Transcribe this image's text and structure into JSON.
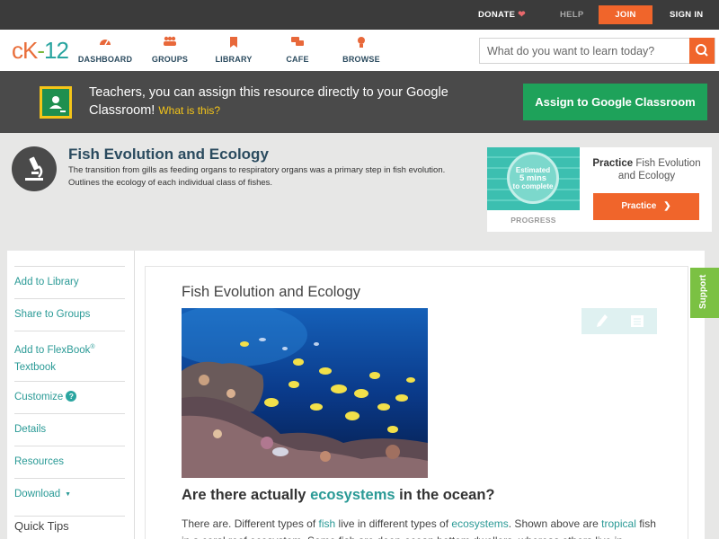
{
  "topbar": {
    "donate": "DONATE",
    "help": "HELP",
    "join": "JOIN",
    "signin": "SIGN IN"
  },
  "nav": {
    "logo_ck": "cK",
    "logo_dash": "-",
    "logo_12": "12",
    "items": [
      {
        "label": "DASHBOARD",
        "icon": "dashboard-icon"
      },
      {
        "label": "GROUPS",
        "icon": "groups-icon"
      },
      {
        "label": "LIBRARY",
        "icon": "library-icon"
      },
      {
        "label": "CAFE",
        "icon": "cafe-icon"
      },
      {
        "label": "BROWSE",
        "icon": "browse-icon"
      }
    ],
    "search_placeholder": "What do you want to learn today?"
  },
  "banner": {
    "text": "Teachers, you can assign this resource directly to your Google Classroom!",
    "what": "What is this?",
    "button": "Assign to Google Classroom"
  },
  "resource": {
    "title": "Fish Evolution and Ecology",
    "description": "The transition from gills as feeding organs to respiratory organs was a primary step in fish evolution. Outlines the ecology of each individual class of fishes."
  },
  "practice": {
    "estimated": "Estimated",
    "mins": "5 mins",
    "complete": "to complete",
    "progress_label": "PROGRESS",
    "title_bold": "Practice",
    "title_rest": "Fish Evolution and Ecology",
    "button": "Practice"
  },
  "sidebar": {
    "add_library": "Add to Library",
    "share_groups": "Share to Groups",
    "add_flexbook": "Add to FlexBook",
    "flexbook_sup": "®",
    "flexbook_line2": "Textbook",
    "customize": "Customize",
    "details": "Details",
    "resources": "Resources",
    "download": "Download",
    "quick_tips": "Quick Tips"
  },
  "article": {
    "title": "Fish Evolution and Ecology",
    "heading_pre": "Are there actually ",
    "heading_link": "ecosystems",
    "heading_post": " in the ocean?",
    "p_1": "There are. Different types of ",
    "p_fish": "fish",
    "p_2": " live in different types of ",
    "p_ecosystems": "ecosystems",
    "p_3": ". Shown above are ",
    "p_tropical": "tropical",
    "p_4": " fish in a coral reef ecosystem. Some fish are deep-ocean bottom dwellers, whereas others live in"
  },
  "support": "Support",
  "colors": {
    "accent_orange": "#f0652b",
    "teal_link": "#2a9a96",
    "google_green": "#1ea25a",
    "support_green": "#7bc143"
  }
}
